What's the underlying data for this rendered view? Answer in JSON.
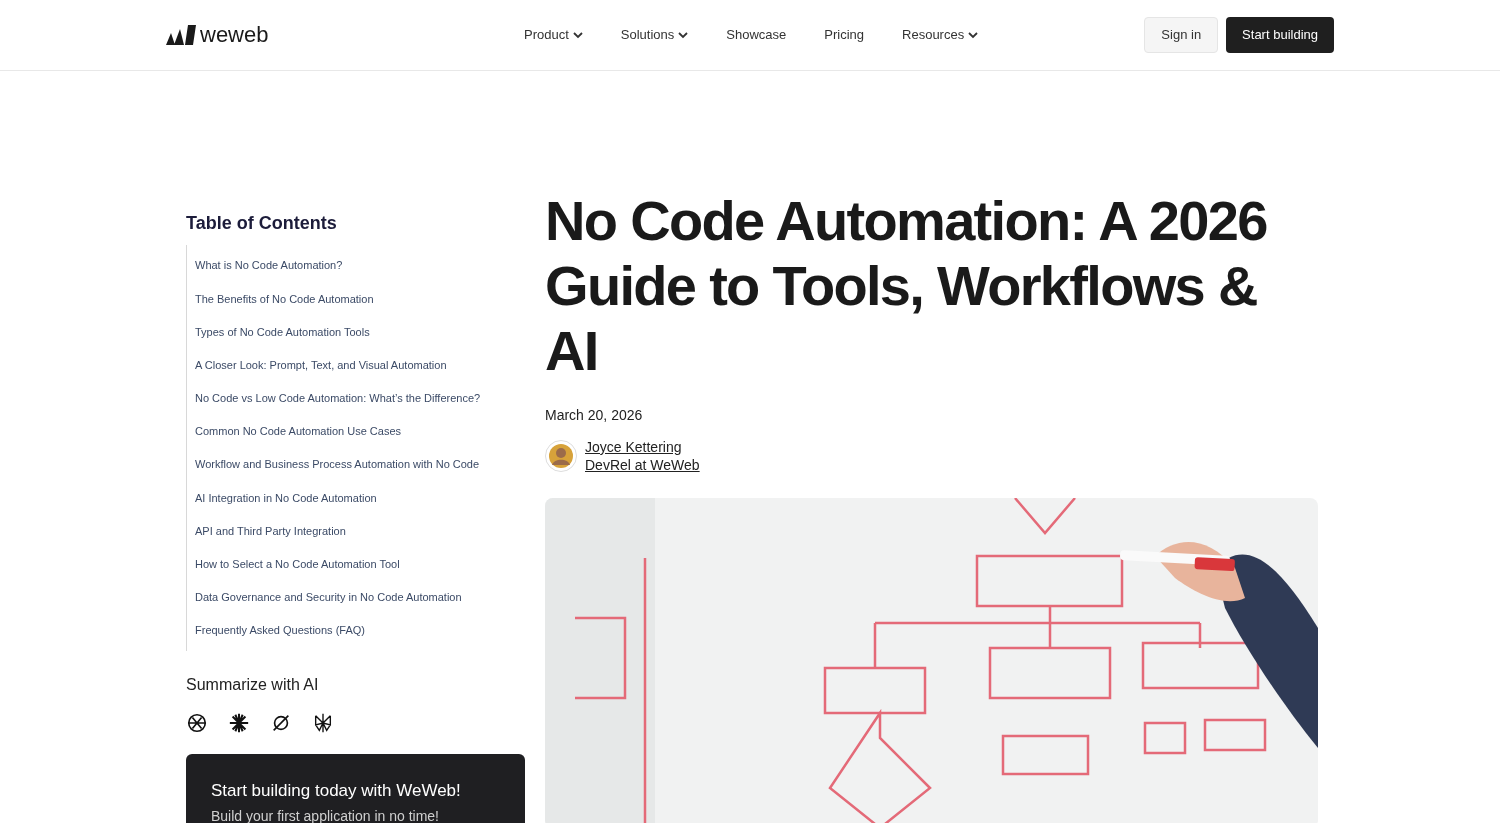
{
  "header": {
    "logo_text": "weweb",
    "nav": [
      {
        "label": "Product",
        "dropdown": true
      },
      {
        "label": "Solutions",
        "dropdown": true
      },
      {
        "label": "Showcase",
        "dropdown": false
      },
      {
        "label": "Pricing",
        "dropdown": false
      },
      {
        "label": "Resources",
        "dropdown": true
      }
    ],
    "sign_in": "Sign in",
    "start": "Start building"
  },
  "toc": {
    "title": "Table of Contents",
    "items": [
      "What is No Code Automation?",
      "The Benefits of No Code Automation",
      "Types of No Code Automation Tools",
      "A Closer Look: Prompt, Text, and Visual Automation",
      "No Code vs Low Code Automation: What’s the Difference?",
      "Common No Code Automation Use Cases",
      "Workflow and Business Process Automation with No Code",
      "AI Integration in No Code Automation",
      "API and Third Party Integration",
      "How to Select a No Code Automation Tool",
      "Data Governance and Security in No Code Automation",
      "Frequently Asked Questions (FAQ)"
    ]
  },
  "summarize": {
    "title": "Summarize with AI"
  },
  "cta": {
    "title": "Start building today with WeWeb!",
    "subtitle": "Build your first application in no time!"
  },
  "article": {
    "title": "No Code Automation: A 2026 Guide to Tools, Workflows & AI",
    "date": "March 20, 2026",
    "author": "Joyce Kettering",
    "role": "DevRel at WeWeb"
  }
}
